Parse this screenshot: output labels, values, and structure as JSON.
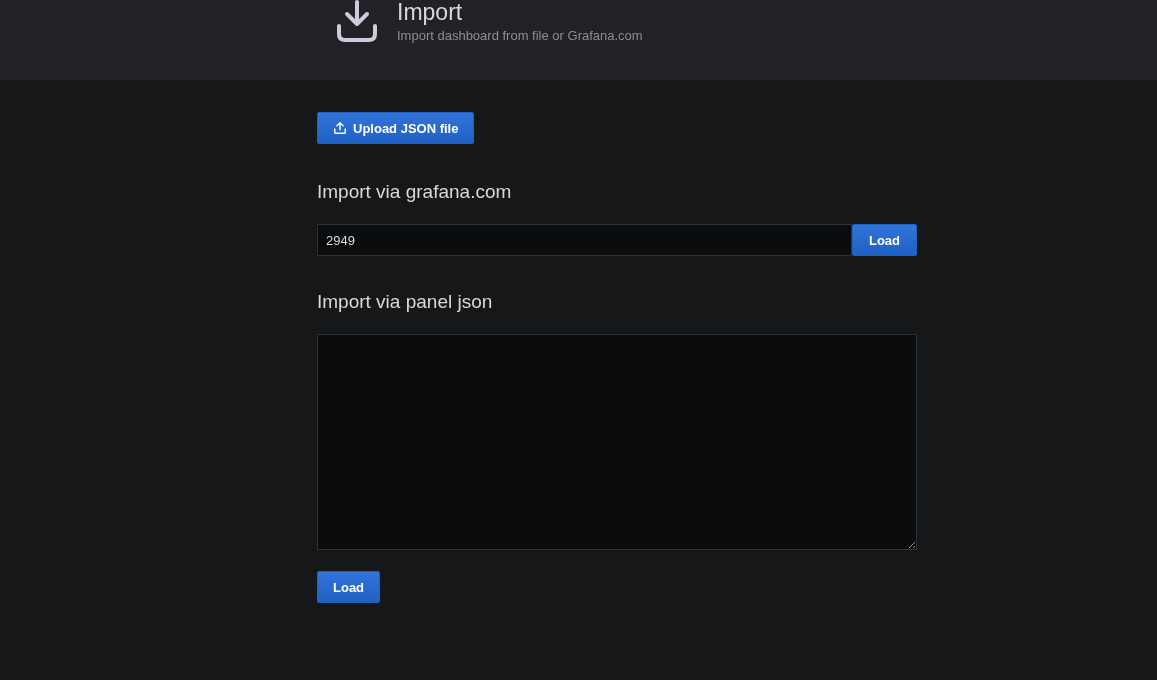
{
  "header": {
    "title": "Import",
    "subtitle": "Import dashboard from file or Grafana.com"
  },
  "upload_button": {
    "label": "Upload JSON file"
  },
  "grafana_section": {
    "heading": "Import via grafana.com",
    "field_value": "2949",
    "button": "Load"
  },
  "json_section": {
    "heading": "Import via panel json",
    "button": "Load"
  }
}
